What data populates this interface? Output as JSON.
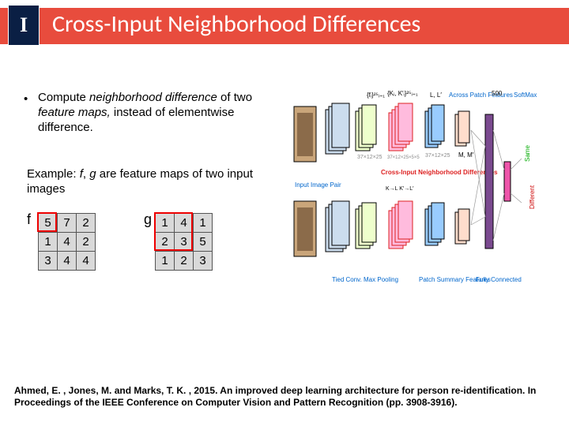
{
  "header": {
    "logo_letter": "I",
    "title": "Cross-Input Neighborhood Differences"
  },
  "bullet": {
    "lead": "Compute ",
    "nbhd_diff": "neighborhood difference",
    "mid": " of two ",
    "feat_maps": "feature maps,",
    "tail": " instead of elementwise difference."
  },
  "example": {
    "lead": "Example: ",
    "f": "f",
    "comma": ", ",
    "g": "g",
    "tail": " are feature maps of two input images"
  },
  "matrices": {
    "f_label": "f",
    "g_label": "g",
    "f": [
      [
        "5",
        "7",
        "2"
      ],
      [
        "1",
        "4",
        "2"
      ],
      [
        "3",
        "4",
        "4"
      ]
    ],
    "g": [
      [
        "1",
        "4",
        "1"
      ],
      [
        "2",
        "3",
        "5"
      ],
      [
        "1",
        "2",
        "3"
      ]
    ]
  },
  "diagram": {
    "labels": {
      "input_pair": "Input Image Pair",
      "tied": "Tied Conv. Max Pooling",
      "cross_input": "Cross-Input Neighborhood Differences",
      "patch_summary": "Patch Summary Features",
      "across_patch": "Across Patch Features",
      "fully_connected": "Fully Connected",
      "softmax": "SoftMax",
      "same": "Same",
      "different": "Different",
      "five_hundred": "500",
      "f_i": "{fᵢ}²⁵ᵢ₌₁",
      "k_k": "{Kᵢ, K′ᵢ}²⁵ᵢ₌₁",
      "l_l": "L, L′",
      "m_m": "M, M′",
      "k5l": "K→L K′→L′",
      "dims_a": "37×12×25",
      "dims_b": "37×12×25×5×5",
      "dims_c": "37×12×25"
    }
  },
  "citation": "Ahmed, E. , Jones, M. and Marks, T. K. , 2015. An improved deep learning architecture for person re-identification. In Proceedings of the IEEE Conference on Computer Vision and Pattern Recognition (pp. 3908-3916)."
}
